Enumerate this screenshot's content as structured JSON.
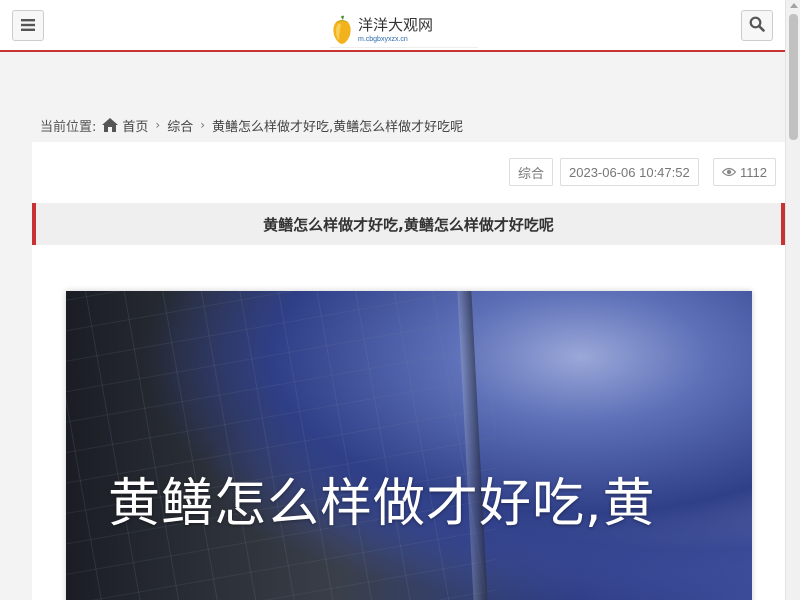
{
  "header": {
    "site_name": "洋洋大观网",
    "site_domain": "m.cbgbxyxzx.cn",
    "menu_icon": "menu-icon",
    "search_icon": "search-icon",
    "accent_color": "#c83232"
  },
  "breadcrumb": {
    "label": "当前位置:",
    "home": "首页",
    "category": "综合",
    "current": "黄鳝怎么样做才好吃,黄鳝怎么样做才好吃呢"
  },
  "article": {
    "category": "综合",
    "date": "2023-06-06 10:47:52",
    "views": "1112",
    "title": "黄鳝怎么样做才好吃,黄鳝怎么样做才好吃呢",
    "hero_text": "黄鳝怎么样做才好吃,黄"
  }
}
